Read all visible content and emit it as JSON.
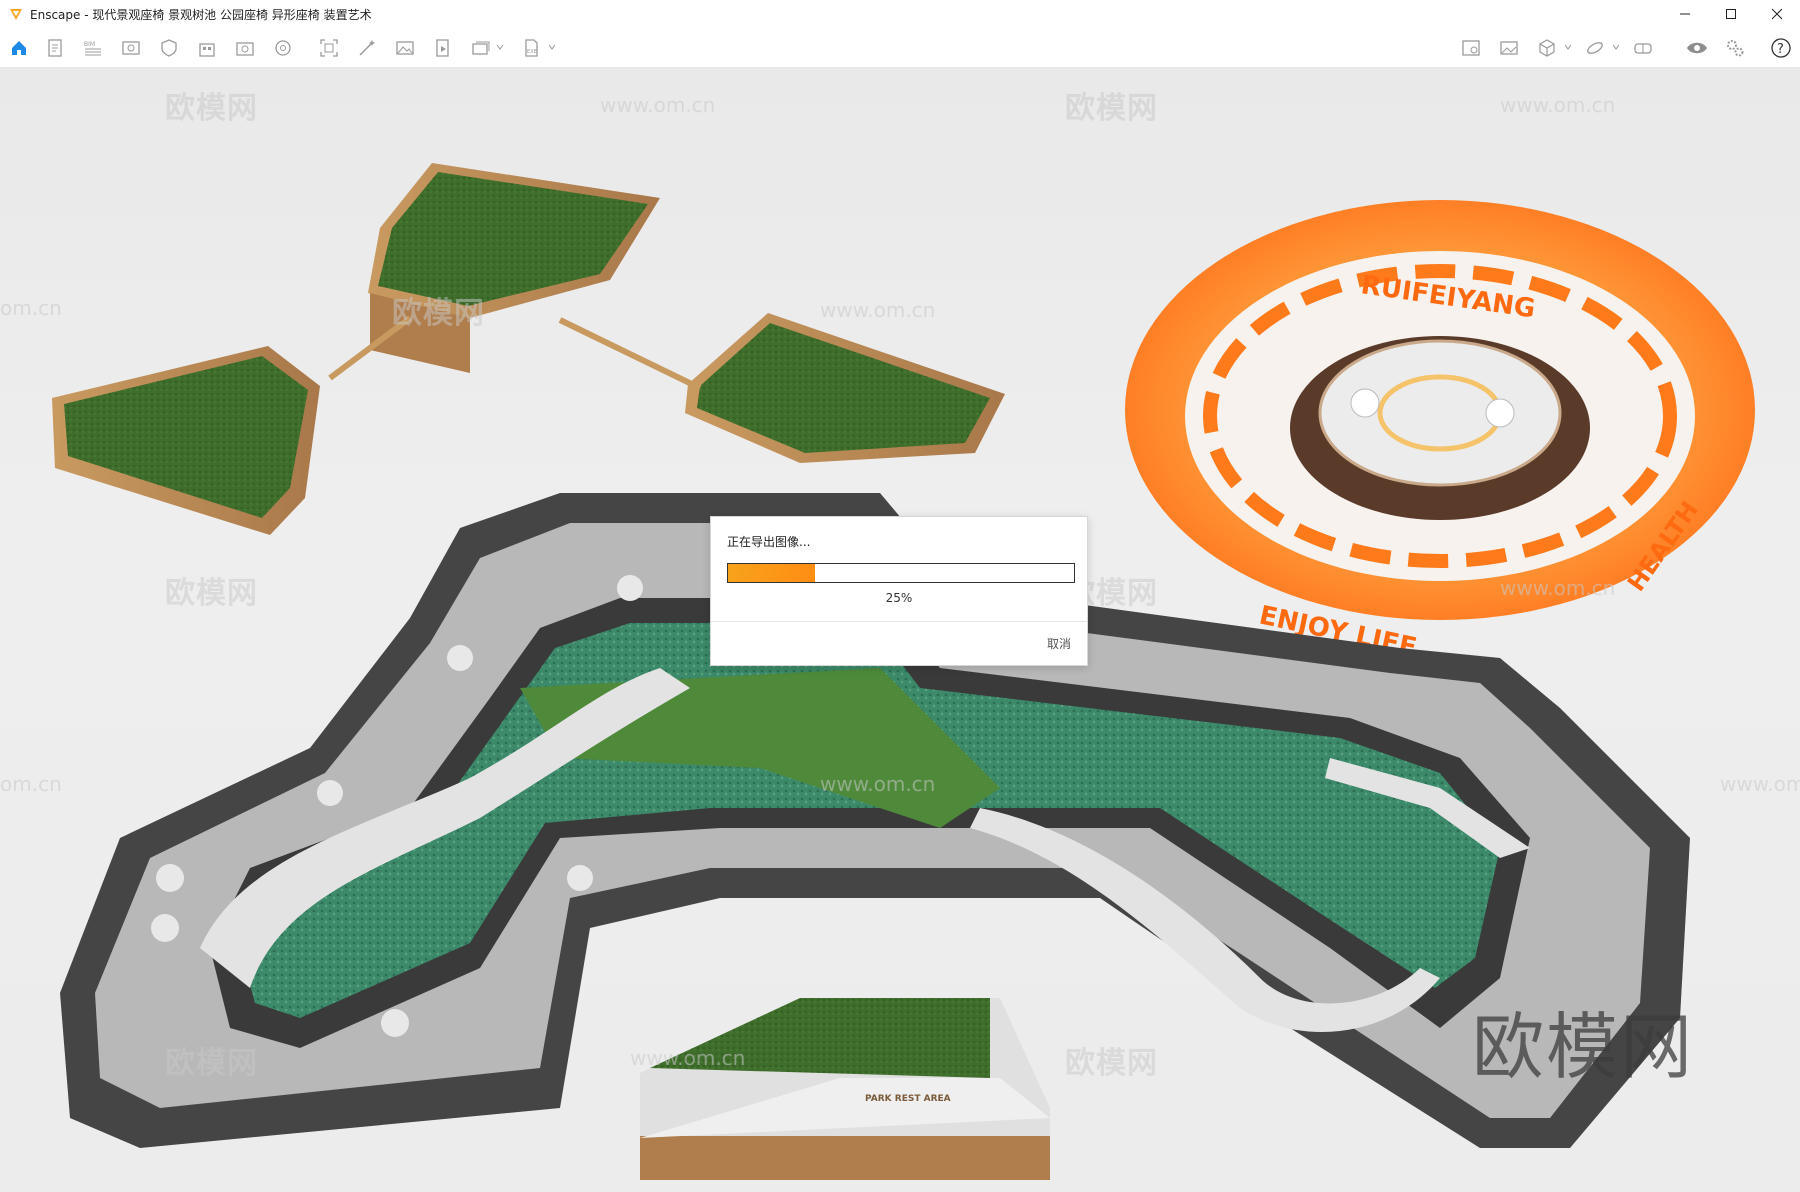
{
  "window": {
    "app_name": "Enscape",
    "title": "Enscape - 现代景观座椅 景观树池 公园座椅 异形座椅 装置艺术"
  },
  "toolbar": {
    "left_icons": [
      "home-icon",
      "document-icon",
      "bim-icon",
      "view-icon",
      "safe-frame-icon",
      "building-icon",
      "asset-library-icon",
      "settings-wheel-icon",
      "capture-icon",
      "magic-wand-icon",
      "image-icon",
      "video-path-icon",
      "batch-render-icon",
      "export-icon"
    ],
    "right_icons": [
      "image-export-icon",
      "screenshot-icon",
      "cube-icon",
      "orbit-icon",
      "vr-headset-icon",
      "eye-icon",
      "settings-gear-icon",
      "help-icon"
    ]
  },
  "scene": {
    "label_top": "RUIFEIYANG",
    "label_bottom": "ENJOY LIFE",
    "label_right": "HEALTH",
    "sign_text": "PARK REST AREA"
  },
  "watermarks": {
    "brand_cn": "欧模网",
    "url": "www.om.cn",
    "url_short": "om.cn"
  },
  "dialog": {
    "title": "正在导出图像...",
    "progress_percent": 25,
    "progress_text": "25%",
    "cancel_label": "取消"
  },
  "colors": {
    "accent_blue": "#1e88e5",
    "progress_orange": "#ff8d14",
    "installation_orange": "#ff7a1a"
  }
}
